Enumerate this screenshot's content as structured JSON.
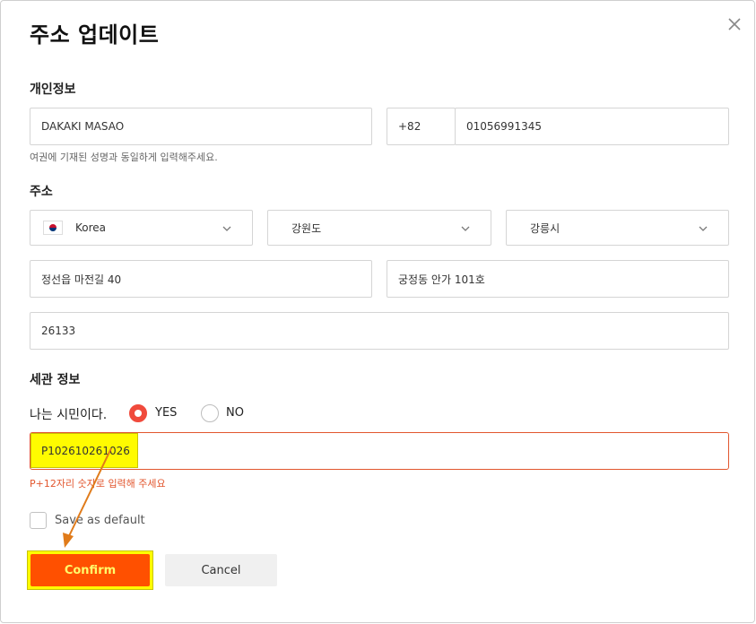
{
  "dialog": {
    "title": "주소 업데이트",
    "close_icon": "close-icon"
  },
  "personal": {
    "section_label": "개인정보",
    "name_value": "DAKAKI MASAO",
    "country_code": "+82",
    "phone_value": "01056991345",
    "hint": "여권에 기재된 성명과 동일하게 입력해주세요."
  },
  "address": {
    "section_label": "주소",
    "country": "Korea",
    "country_flag_icon": "korea-flag-icon",
    "province": "강원도",
    "city": "강릉시",
    "street": "정선읍 마전길 40",
    "detail": "궁정동 안가 101호",
    "postal_code": "26133"
  },
  "customs": {
    "section_label": "세관 정보",
    "citizen_question": "나는 시민이다.",
    "option_yes": "YES",
    "option_no": "NO",
    "selected": "YES",
    "tax_id_value": "P102610261026",
    "error_text": "P+12자리 숫자로 입력해 주세요"
  },
  "footer": {
    "save_default_label": "Save as default",
    "save_default_checked": false,
    "confirm_label": "Confirm",
    "cancel_label": "Cancel"
  },
  "colors": {
    "accent": "#ff5000",
    "error": "#e2562e",
    "radio_selected": "#f04a3c",
    "highlight": "#fffb00",
    "arrow": "#e07b1a"
  }
}
